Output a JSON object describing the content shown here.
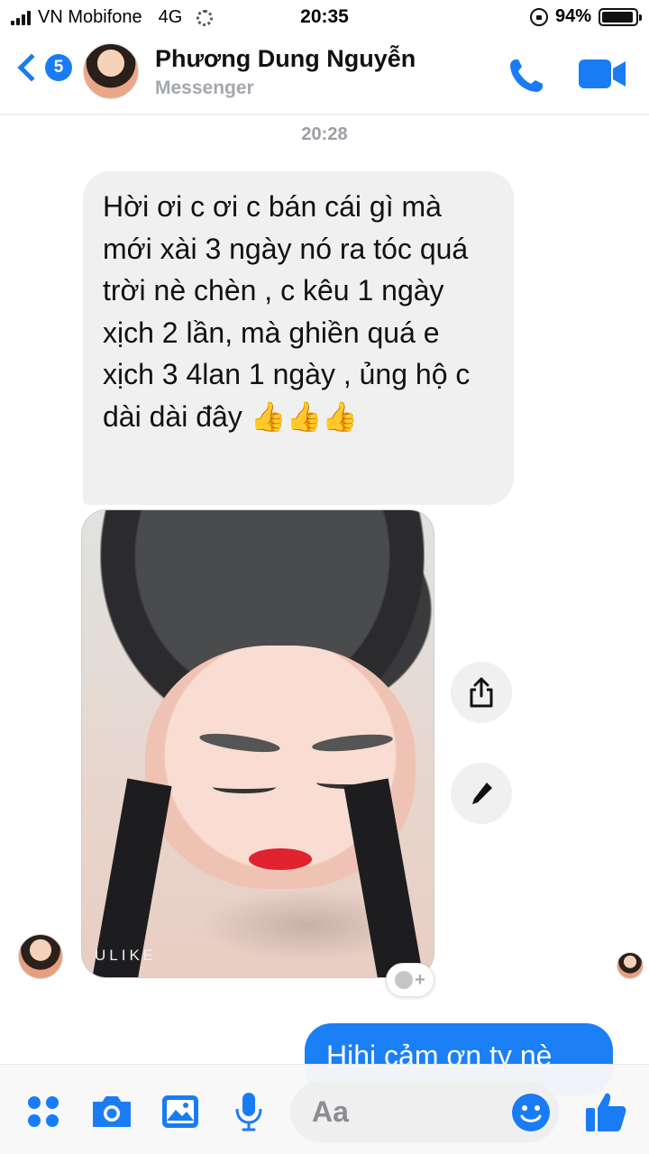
{
  "status_bar": {
    "carrier": "VN Mobifone",
    "network": "4G",
    "time": "20:35",
    "battery": "94%",
    "battery_level": 0.94
  },
  "header": {
    "back_badge": "5",
    "contact_name": "Phương Dung Nguyễn",
    "subtitle": "Messenger",
    "call_icon": "phone-icon",
    "video_icon": "video-camera-icon"
  },
  "conversation": {
    "timestamp": "20:28",
    "incoming_text": "Hời ơi c ơi c bán cái gì mà mới xài 3 ngày nó ra tóc quá trời nè chèn , c kêu 1 ngày xịch 2 lần,  mà ghiền quá e xịch 3 4lan 1 ngày , ủng hộ c dài dài đây",
    "incoming_emoji": "👍👍👍",
    "photo_watermark": "ULIKE",
    "share_icon": "share-icon",
    "edit_icon": "pencil-icon",
    "reaction_add": "+",
    "outgoing_text": "Hihi cảm ơn ty nè"
  },
  "composer": {
    "placeholder": "Aa",
    "icons": [
      "apps-icon",
      "camera-icon",
      "gallery-icon",
      "microphone-icon",
      "emoji-icon",
      "thumbs-up-icon"
    ]
  },
  "colors": {
    "accent": "#1a7cf5",
    "incoming_bubble": "#f0f0f0",
    "outgoing_bubble": "#1b7ff5",
    "muted_text": "#9b9ea3"
  }
}
